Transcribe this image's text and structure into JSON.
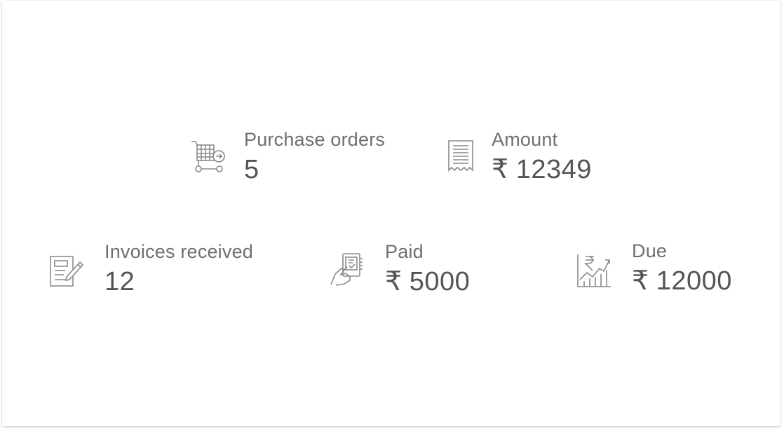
{
  "stats": {
    "purchase_orders": {
      "label": "Purchase orders",
      "value": "5",
      "icon": "shopping-cart-icon"
    },
    "amount": {
      "label": "Amount",
      "currency": "₹",
      "value": "12349",
      "icon": "receipt-icon"
    },
    "invoices_received": {
      "label": "Invoices received",
      "value": "12",
      "icon": "invoice-edit-icon"
    },
    "paid": {
      "label": "Paid",
      "currency": "₹",
      "value": "5000",
      "icon": "hand-payment-icon"
    },
    "due": {
      "label": "Due",
      "currency": "₹",
      "value": "12000",
      "icon": "rupee-growth-chart-icon"
    }
  },
  "colors": {
    "label": "#6f6f6f",
    "value": "#555555",
    "icon": "#8a8a8a"
  }
}
